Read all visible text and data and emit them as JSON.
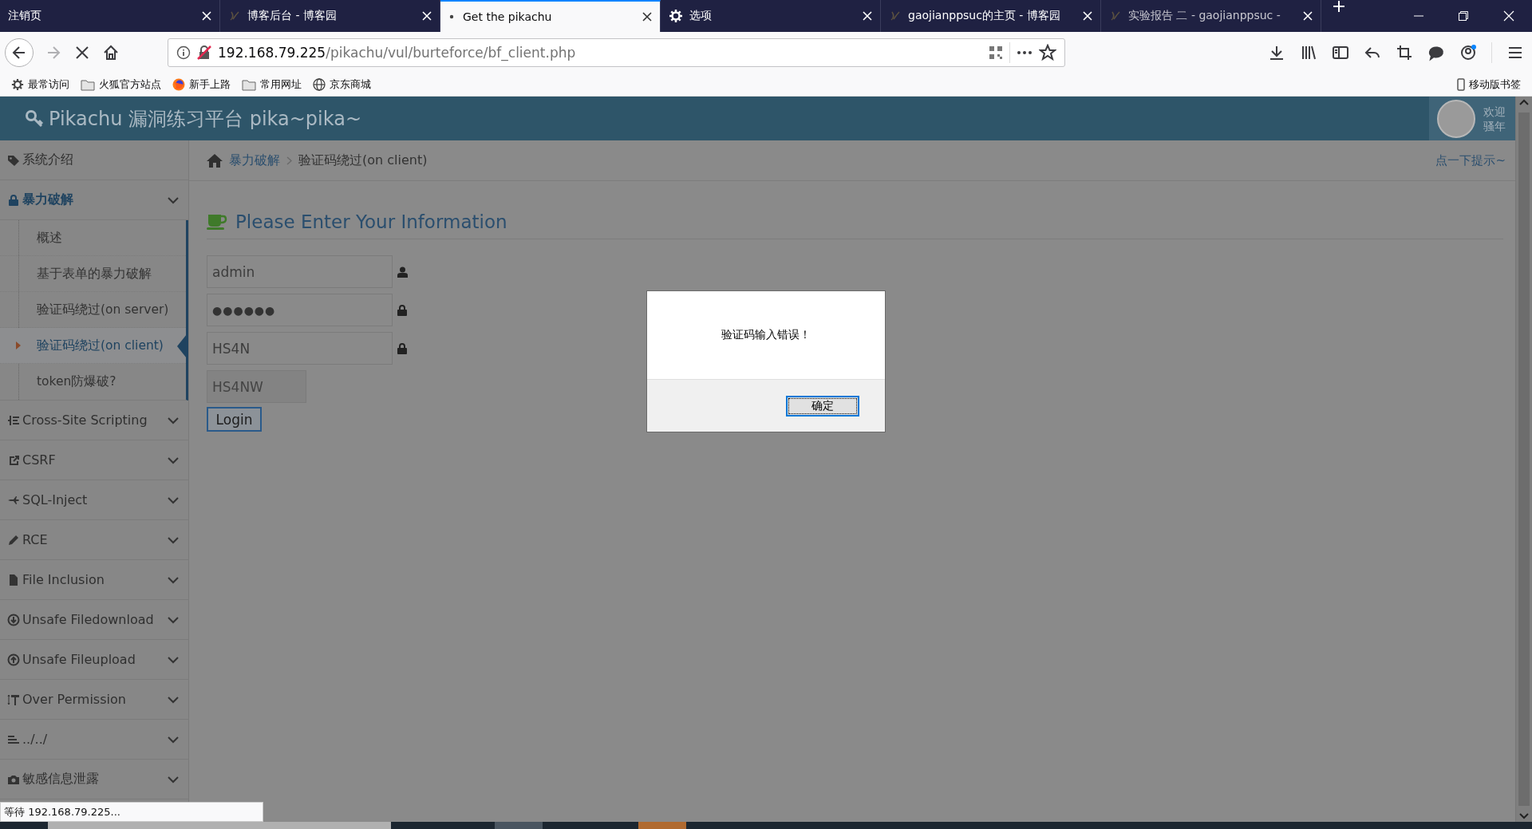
{
  "browser": {
    "tabs": [
      {
        "title": "注销页",
        "kind": "plain",
        "selected": false
      },
      {
        "title": "博客后台 - 博客园",
        "kind": "site",
        "selected": false
      },
      {
        "title": "Get the pikachu",
        "kind": "loading",
        "selected": true
      },
      {
        "title": "选项",
        "kind": "settings",
        "selected": false
      },
      {
        "title": "gaojianppsuc的主页 - 博客园",
        "kind": "site",
        "selected": false
      },
      {
        "title": "实验报告 二 - gaojianppsuc -",
        "kind": "site",
        "selected": false
      }
    ],
    "url_host": "192.168.79.225",
    "url_path": "/pikachu/vul/burteforce/bf_client.php",
    "bookmarks": [
      {
        "label": "最常访问",
        "kind": "gear"
      },
      {
        "label": "火狐官方站点",
        "kind": "folder"
      },
      {
        "label": "新手上路",
        "kind": "firefox"
      },
      {
        "label": "常用网址",
        "kind": "folder"
      },
      {
        "label": "京东商城",
        "kind": "globe"
      }
    ],
    "mobile_bookmarks": "移动版书签"
  },
  "header": {
    "title": "Pikachu 漏洞练习平台 pika~pika~",
    "welcome_lines": [
      "欢迎",
      "骚年"
    ]
  },
  "sidebar": {
    "items": [
      {
        "label": "系统介绍",
        "kind": "link",
        "selected": false
      },
      {
        "label": "暴力破解",
        "kind": "group",
        "selected": true,
        "expanded": true,
        "children": [
          {
            "label": "概述",
            "selected": false
          },
          {
            "label": "基于表单的暴力破解",
            "selected": false
          },
          {
            "label": "验证码绕过(on server)",
            "selected": false
          },
          {
            "label": "验证码绕过(on client)",
            "selected": true
          },
          {
            "label": "token防爆破?",
            "selected": false
          }
        ]
      },
      {
        "label": "Cross-Site Scripting",
        "kind": "group",
        "selected": false
      },
      {
        "label": "CSRF",
        "kind": "group",
        "selected": false
      },
      {
        "label": "SQL-Inject",
        "kind": "group",
        "selected": false
      },
      {
        "label": "RCE",
        "kind": "group",
        "selected": false
      },
      {
        "label": "File Inclusion",
        "kind": "group",
        "selected": false
      },
      {
        "label": "Unsafe Filedownload",
        "kind": "group",
        "selected": false
      },
      {
        "label": "Unsafe Fileupload",
        "kind": "group",
        "selected": false
      },
      {
        "label": "Over Permission",
        "kind": "group",
        "selected": false
      },
      {
        "label": "../../",
        "kind": "group",
        "selected": false
      },
      {
        "label": "敏感信息泄露",
        "kind": "group",
        "selected": false
      }
    ]
  },
  "breadcrumb": {
    "items": [
      "暴力破解",
      "验证码绕过(on client)"
    ],
    "hint": "点一下提示~"
  },
  "form": {
    "title": "Please Enter Your Information",
    "fields": [
      {
        "kind": "text",
        "value": "admin"
      },
      {
        "kind": "password",
        "value": "●●●●●●"
      },
      {
        "kind": "captcha_input",
        "value": "HS4N"
      },
      {
        "kind": "captcha",
        "value": "HS4NW"
      }
    ],
    "button": "Login"
  },
  "dialog": {
    "message": "验证码输入错误！",
    "button": "确定",
    "focused": true
  },
  "status_bar": "等待 192.168.79.225..."
}
